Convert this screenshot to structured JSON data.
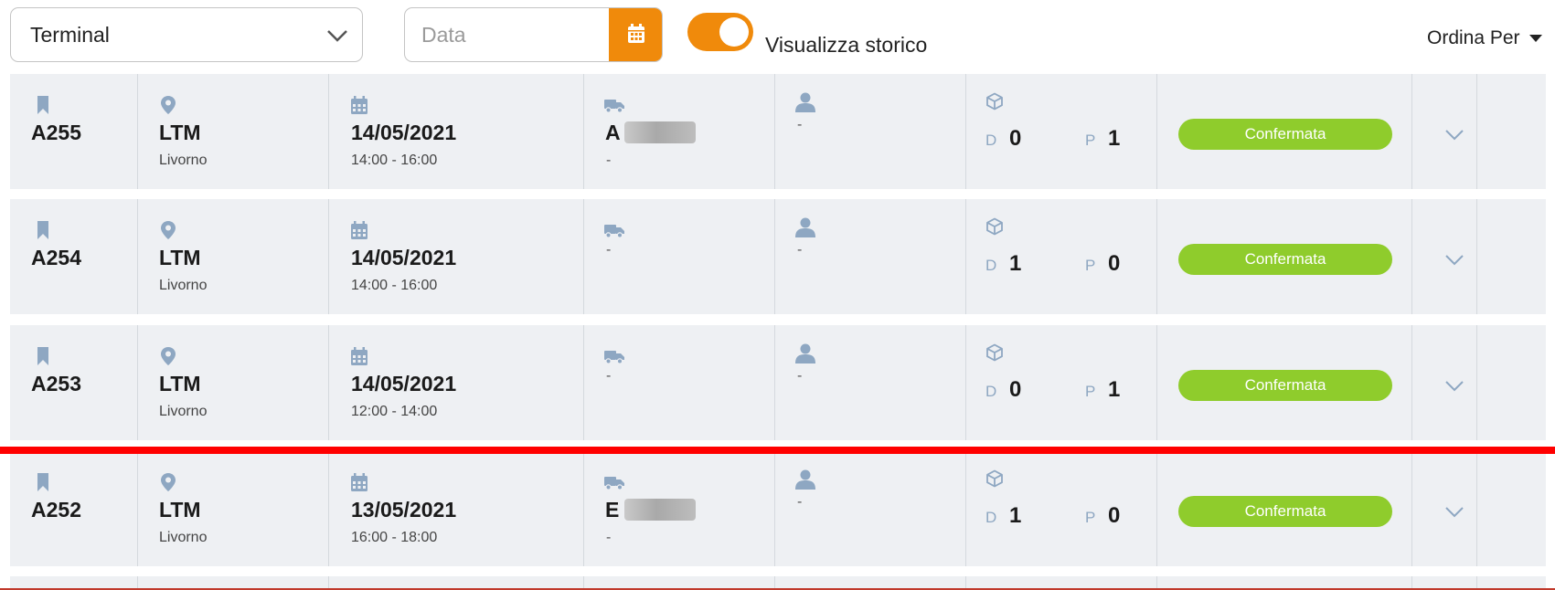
{
  "filters": {
    "terminal_select": "Terminal",
    "date_placeholder": "Data",
    "history_toggle_label": "Visualizza storico",
    "history_toggle_on": true,
    "sort_label": "Ordina Per"
  },
  "colors": {
    "accent": "#f08a0b",
    "status_confirmed": "#8fcc2c",
    "icon": "#8ea7c2",
    "separator": "#ff0000"
  },
  "rows": [
    {
      "id": "A255",
      "terminal": "LTM",
      "city": "Livorno",
      "date": "14/05/2021",
      "time": "14:00 - 16:00",
      "vehicle": "A",
      "vehicle_sub": "-",
      "driver": "-",
      "d_label": "D",
      "d_value": "0",
      "p_label": "P",
      "p_value": "1",
      "status": "Confermata"
    },
    {
      "id": "A254",
      "terminal": "LTM",
      "city": "Livorno",
      "date": "14/05/2021",
      "time": "14:00 - 16:00",
      "vehicle": "",
      "vehicle_sub": "-",
      "driver": "-",
      "d_label": "D",
      "d_value": "1",
      "p_label": "P",
      "p_value": "0",
      "status": "Confermata"
    },
    {
      "id": "A253",
      "terminal": "LTM",
      "city": "Livorno",
      "date": "14/05/2021",
      "time": "12:00 - 14:00",
      "vehicle": "",
      "vehicle_sub": "-",
      "driver": "-",
      "d_label": "D",
      "d_value": "0",
      "p_label": "P",
      "p_value": "1",
      "status": "Confermata"
    },
    {
      "id": "A252",
      "terminal": "LTM",
      "city": "Livorno",
      "date": "13/05/2021",
      "time": "16:00 - 18:00",
      "vehicle": "E",
      "vehicle_sub": "-",
      "driver": "-",
      "d_label": "D",
      "d_value": "1",
      "p_label": "P",
      "p_value": "0",
      "status": "Confermata"
    }
  ]
}
